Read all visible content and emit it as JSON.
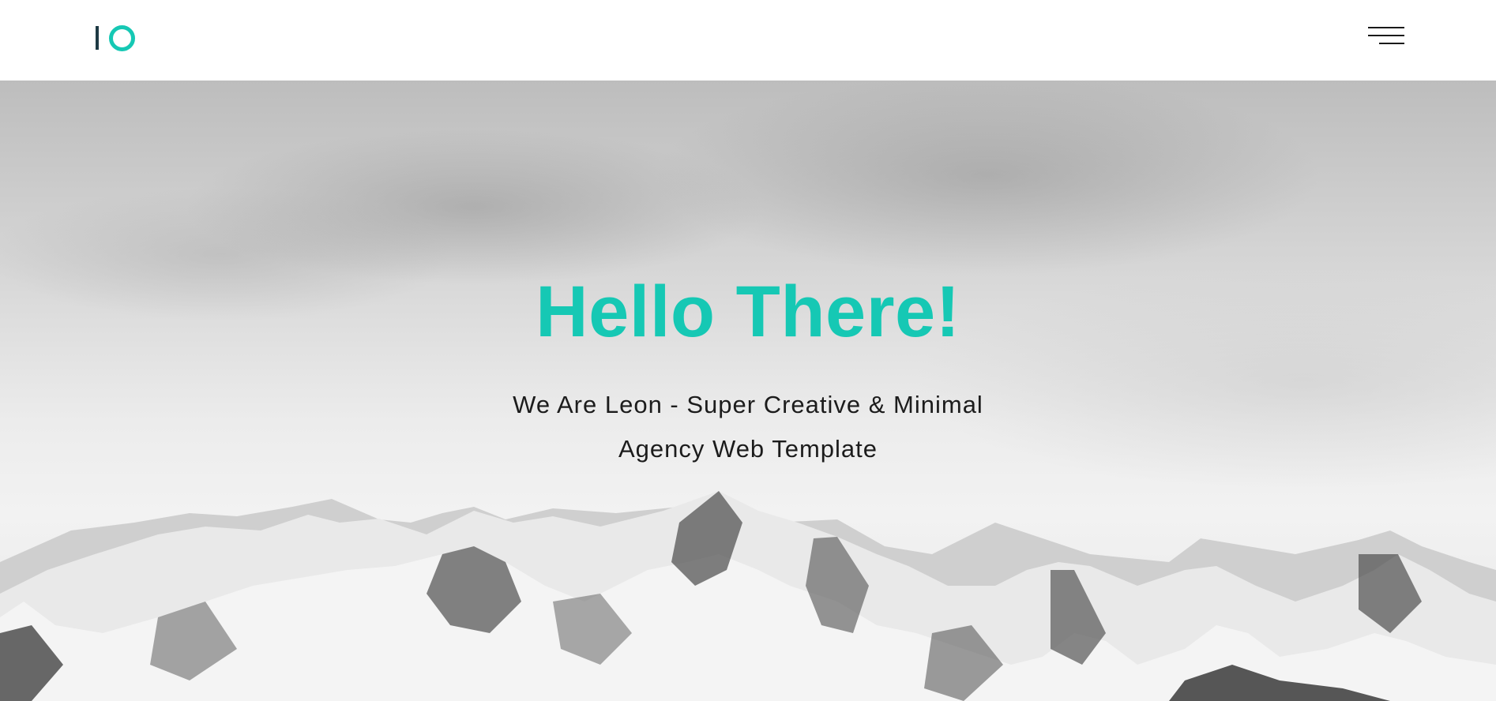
{
  "header": {
    "logo_icon": "io-logo-icon",
    "menu_icon": "hamburger-menu-icon"
  },
  "hero": {
    "title": "Hello There!",
    "subtitle_line1": "We Are Leon - Super Creative & Minimal",
    "subtitle_line2": "Agency Web Template",
    "background": "snowy-mountains-image"
  },
  "colors": {
    "accent": "#16c8b4",
    "logo_dark": "#1e3a44",
    "text": "#1c1c1c"
  }
}
